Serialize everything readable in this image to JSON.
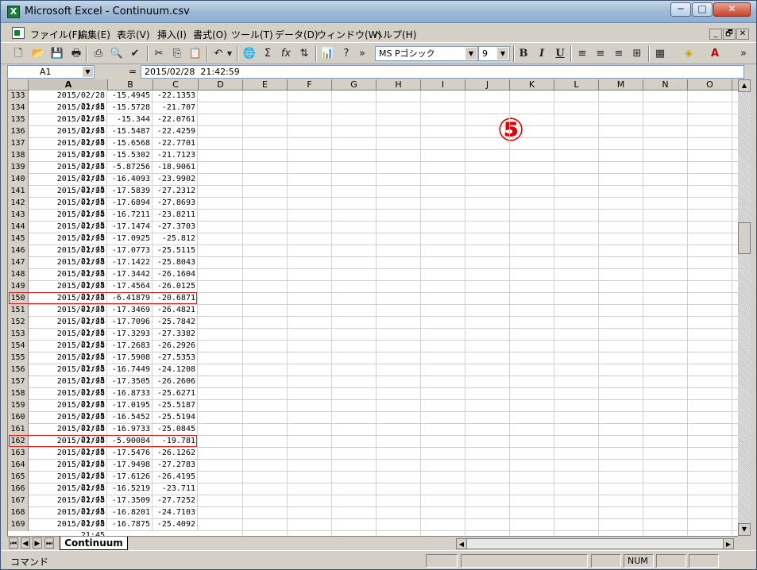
{
  "window": {
    "title": "Microsoft Excel - Continuum.csv",
    "app_icon_letter": "X"
  },
  "caption_buttons": {
    "minimize": "─",
    "maximize": "□",
    "close": "✕"
  },
  "menus": [
    "ファイル(F)",
    "編集(E)",
    "表示(V)",
    "挿入(I)",
    "書式(O)",
    "ツール(T)",
    "データ(D)",
    "ウィンドウ(W)",
    "ヘルプ(H)"
  ],
  "mdi_buttons": {
    "minimize": "_",
    "restore": "🗗",
    "close": "✕"
  },
  "toolbar": {
    "font_name": "MS Pゴシック",
    "font_size": "9",
    "bold": "B",
    "italic": "I",
    "underline": "U"
  },
  "formula_bar": {
    "cell_ref": "A1",
    "eq": "=",
    "formula": "2015/02/28  21:42:59"
  },
  "columns": [
    "A",
    "B",
    "C",
    "D",
    "E",
    "F",
    "G",
    "H",
    "I",
    "J",
    "K",
    "L",
    "M",
    "N",
    "O"
  ],
  "rows": [
    {
      "n": "133",
      "a": "2015/02/28 21:45",
      "b": "-15.4945",
      "c": "-22.1353"
    },
    {
      "n": "134",
      "a": "2015/02/28 21:45",
      "b": "-15.5728",
      "c": "-21.707"
    },
    {
      "n": "135",
      "a": "2015/02/28 21:45",
      "b": "-15.344",
      "c": "-22.0761"
    },
    {
      "n": "136",
      "a": "2015/02/28 21:45",
      "b": "-15.5487",
      "c": "-22.4259"
    },
    {
      "n": "137",
      "a": "2015/02/28 21:45",
      "b": "-15.6568",
      "c": "-22.7701"
    },
    {
      "n": "138",
      "a": "2015/02/28 21:45",
      "b": "-15.5302",
      "c": "-21.7123"
    },
    {
      "n": "139",
      "a": "2015/02/28 21:45",
      "b": "-5.87256",
      "c": "-18.9061"
    },
    {
      "n": "140",
      "a": "2015/02/28 21:45",
      "b": "-16.4093",
      "c": "-23.9902"
    },
    {
      "n": "141",
      "a": "2015/02/28 21:45",
      "b": "-17.5839",
      "c": "-27.2312"
    },
    {
      "n": "142",
      "a": "2015/02/28 21:45",
      "b": "-17.6894",
      "c": "-27.8693"
    },
    {
      "n": "143",
      "a": "2015/02/28 21:45",
      "b": "-16.7211",
      "c": "-23.8211"
    },
    {
      "n": "144",
      "a": "2015/02/28 21:45",
      "b": "-17.1474",
      "c": "-27.3703"
    },
    {
      "n": "145",
      "a": "2015/02/28 21:45",
      "b": "-17.0925",
      "c": "-25.812"
    },
    {
      "n": "146",
      "a": "2015/02/28 21:45",
      "b": "-17.0773",
      "c": "-25.5115"
    },
    {
      "n": "147",
      "a": "2015/02/28 21:45",
      "b": "-17.1422",
      "c": "-25.8043"
    },
    {
      "n": "148",
      "a": "2015/02/28 21:45",
      "b": "-17.3442",
      "c": "-26.1604"
    },
    {
      "n": "149",
      "a": "2015/02/28 21:45",
      "b": "-17.4564",
      "c": "-26.0125"
    },
    {
      "n": "150",
      "a": "2015/02/28 21:45",
      "b": "-6.41879",
      "c": "-20.6871",
      "highlight": true
    },
    {
      "n": "151",
      "a": "2015/02/28 21:45",
      "b": "-17.3469",
      "c": "-26.4821"
    },
    {
      "n": "152",
      "a": "2015/02/28 21:45",
      "b": "-17.7096",
      "c": "-25.7842"
    },
    {
      "n": "153",
      "a": "2015/02/28 21:45",
      "b": "-17.3293",
      "c": "-27.3382"
    },
    {
      "n": "154",
      "a": "2015/02/28 21:45",
      "b": "-17.2683",
      "c": "-26.2926"
    },
    {
      "n": "155",
      "a": "2015/02/28 21:45",
      "b": "-17.5908",
      "c": "-27.5353"
    },
    {
      "n": "156",
      "a": "2015/02/28 21:45",
      "b": "-16.7449",
      "c": "-24.1208"
    },
    {
      "n": "157",
      "a": "2015/02/28 21:45",
      "b": "-17.3505",
      "c": "-26.2606"
    },
    {
      "n": "158",
      "a": "2015/02/28 21:45",
      "b": "-16.8733",
      "c": "-25.6271"
    },
    {
      "n": "159",
      "a": "2015/02/28 21:45",
      "b": "-17.0195",
      "c": "-25.5187"
    },
    {
      "n": "160",
      "a": "2015/02/28 21:45",
      "b": "-16.5452",
      "c": "-25.5194"
    },
    {
      "n": "161",
      "a": "2015/02/28 21:45",
      "b": "-16.9733",
      "c": "-25.0845"
    },
    {
      "n": "162",
      "a": "2015/02/28 21:45",
      "b": "-5.90084",
      "c": "-19.781",
      "highlight": true
    },
    {
      "n": "163",
      "a": "2015/02/28 21:45",
      "b": "-17.5476",
      "c": "-26.1262"
    },
    {
      "n": "164",
      "a": "2015/02/28 21:45",
      "b": "-17.9498",
      "c": "-27.2783"
    },
    {
      "n": "165",
      "a": "2015/02/28 21:45",
      "b": "-17.6126",
      "c": "-26.4195"
    },
    {
      "n": "166",
      "a": "2015/02/28 21:45",
      "b": "-16.5219",
      "c": "-23.711"
    },
    {
      "n": "167",
      "a": "2015/02/28 21:45",
      "b": "-17.3509",
      "c": "-27.7252"
    },
    {
      "n": "168",
      "a": "2015/02/28 21:45",
      "b": "-16.8201",
      "c": "-24.7103"
    },
    {
      "n": "169",
      "a": "2015/02/28 21:45",
      "b": "-16.7875",
      "c": "-25.4092"
    }
  ],
  "annotation": {
    "marker": "⑤",
    "color": "#e00000"
  },
  "highlight_color": "#e02020",
  "sheet_tab": "Continuum",
  "status": {
    "text": "コマンド",
    "num": "NUM"
  }
}
